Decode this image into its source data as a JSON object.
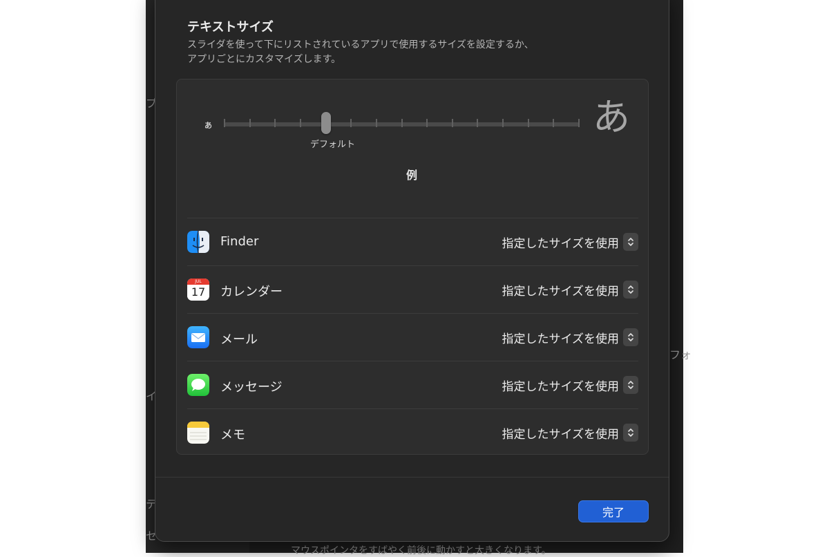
{
  "sheet": {
    "title": "テキストサイズ",
    "description_line1": "スライダを使って下にリストされているアプリで使用するサイズを設定するか、",
    "description_line2": "アプリごとにカスタマイズします。",
    "done_label": "完了"
  },
  "slider": {
    "small_glyph": "あ",
    "large_glyph": "あ",
    "thumb_label": "デフォルト",
    "tick_count": 15,
    "selected_index": 4
  },
  "preview": {
    "label": "例"
  },
  "apps": [
    {
      "name": "Finder",
      "icon": "finder-icon",
      "setting": "指定したサイズを使用"
    },
    {
      "name": "カレンダー",
      "icon": "calendar-icon",
      "setting": "指定したサイズを使用",
      "icon_month": "JUL",
      "icon_day": "17"
    },
    {
      "name": "メール",
      "icon": "mail-icon",
      "setting": "指定したサイズを使用"
    },
    {
      "name": "メッセージ",
      "icon": "messages-icon",
      "setting": "指定したサイズを使用"
    },
    {
      "name": "メモ",
      "icon": "notes-icon",
      "setting": "指定したサイズを使用"
    }
  ],
  "background": {
    "fragment_1": "プ",
    "fragment_2": "イ",
    "fragment_3": "テ",
    "fragment_4": "セ",
    "fragment_5": "フォ",
    "footer_text": "マウスポインタをすばやく前後に動かすと大きくなります。"
  },
  "colors": {
    "accent": "#2160d4",
    "sheet_bg": "#262626",
    "panel_bg": "#2d2d2d"
  }
}
